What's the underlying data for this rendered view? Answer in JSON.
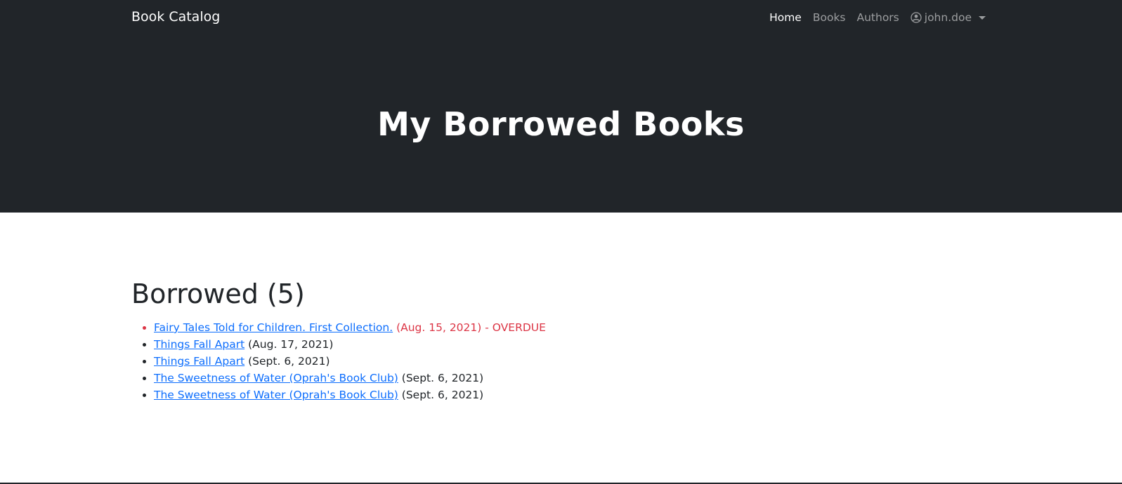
{
  "navbar": {
    "brand": "Book Catalog",
    "links": [
      {
        "label": "Home",
        "active": true
      },
      {
        "label": "Books",
        "active": false
      },
      {
        "label": "Authors",
        "active": false
      }
    ],
    "user": {
      "name": "john.doe",
      "icon": "user-circle-icon"
    }
  },
  "hero": {
    "title": "My Borrowed Books"
  },
  "borrowed": {
    "heading": "Borrowed (5)",
    "items": [
      {
        "title": "Fairy Tales Told for Children. First Collection.",
        "detail": "(Aug. 15, 2021) - OVERDUE",
        "overdue": true
      },
      {
        "title": "Things Fall Apart",
        "detail": "(Aug. 17, 2021)",
        "overdue": false
      },
      {
        "title": "Things Fall Apart",
        "detail": "(Sept. 6, 2021)",
        "overdue": false
      },
      {
        "title": "The Sweetness of Water (Oprah's Book Club)",
        "detail": "(Sept. 6, 2021)",
        "overdue": false
      },
      {
        "title": "The Sweetness of Water (Oprah's Book Club)",
        "detail": "(Sept. 6, 2021)",
        "overdue": false
      }
    ]
  },
  "colors": {
    "navbar_bg": "#212529",
    "link": "#0d6efd",
    "overdue": "#dc3545"
  }
}
